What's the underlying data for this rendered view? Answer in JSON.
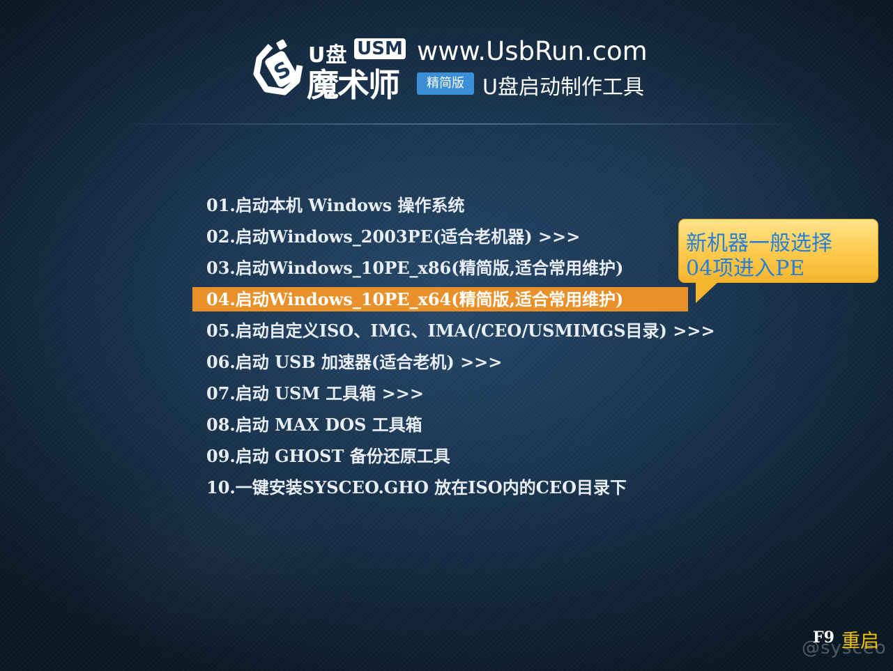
{
  "header": {
    "brand_top": "U盘",
    "brand_usm": "USM",
    "brand_main": "魔术师",
    "site_url": "www.UsbRun.com",
    "edition_badge": "精简版",
    "product_name": "U盘启动制作工具"
  },
  "menu": {
    "selected_index": 3,
    "items": [
      {
        "label": "01.启动本机 Windows 操作系统"
      },
      {
        "label": "02.启动Windows_2003PE(适合老机器) >>>"
      },
      {
        "label": "03.启动Windows_10PE_x86(精简版,适合常用维护)"
      },
      {
        "label": "04.启动Windows_10PE_x64(精简版,适合常用维护)"
      },
      {
        "label": "05.启动自定义ISO、IMG、IMA(/CEO/USMIMGS目录) >>>"
      },
      {
        "label": "06.启动 USB 加速器(适合老机) >>>"
      },
      {
        "label": "07.启动 USM 工具箱 >>>"
      },
      {
        "label": "08.启动 MAX DOS 工具箱"
      },
      {
        "label": "09.启动 GHOST 备份还原工具"
      },
      {
        "label": "10.一键安装SYSCEO.GHO  放在ISO内的CEO目录下"
      }
    ]
  },
  "callout": {
    "line1": "新机器一般选择",
    "line2": "04项进入PE"
  },
  "footer": {
    "key": "F9",
    "label": "重启",
    "watermark": "@sysceo"
  },
  "colors": {
    "selection": "#e8912a",
    "callout_bg": "#fcc94a",
    "callout_text": "#2a7fd4",
    "footer_label": "#f5c400",
    "badge": "#3b8fd6"
  },
  "icons": {
    "logo": "usm-logo-icon"
  }
}
